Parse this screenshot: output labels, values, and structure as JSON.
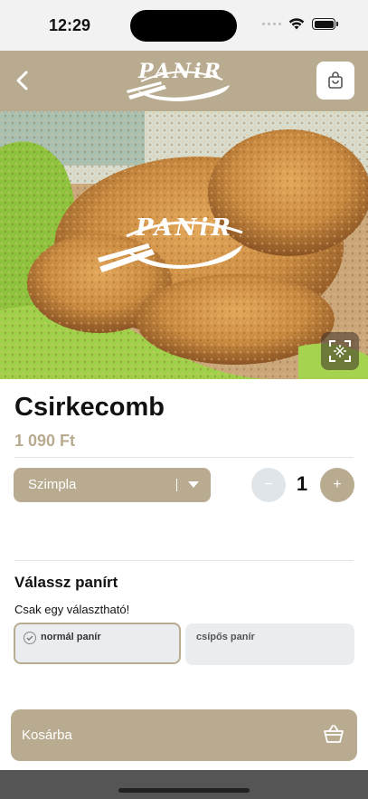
{
  "status_bar": {
    "time": "12:29"
  },
  "header": {
    "back_icon": "chevron-left-icon",
    "logo_text": "PANiR",
    "cart_icon": "shopping-bag-icon"
  },
  "hero": {
    "overlay_logo_text": "PANiR",
    "expand_icon": "expand-icon"
  },
  "product": {
    "name": "Csirkecomb",
    "price": "1 090 Ft"
  },
  "size_select": {
    "value": "Szimpla"
  },
  "quantity": {
    "minus": "−",
    "value": "1",
    "plus": "+"
  },
  "breading": {
    "title": "Válassz panírt",
    "subtitle": "Csak egy választható!",
    "options": [
      {
        "label": "normál panír",
        "selected": true
      },
      {
        "label": "csípős panír",
        "selected": false
      }
    ]
  },
  "cart_button": {
    "label": "Kosárba",
    "icon": "basket-icon"
  },
  "colors": {
    "accent": "#b8ab90",
    "option_bg": "#e9edf0"
  }
}
